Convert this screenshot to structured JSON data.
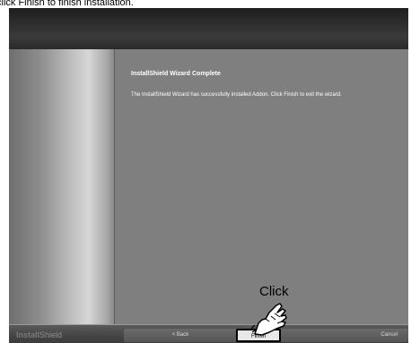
{
  "caption": "click Finish to finish installation.",
  "wizard": {
    "heading": "InstallShield Wizard Complete",
    "message": "The InstallShield Wizard has successfully installed Addon.  Click Finish to exit the wizard."
  },
  "footer": {
    "brand_part1": "Install",
    "brand_part2": "Shield",
    "back_label": "< Back",
    "finish_label": "Finish",
    "cancel_label": "Cancel"
  },
  "annotation": {
    "click_text": "Click"
  },
  "colors": {
    "background": "#7f7f7f",
    "title_bar": "#2a2a2a",
    "finish_border": "#000000"
  },
  "icons": [
    "pointing-hand-icon"
  ]
}
